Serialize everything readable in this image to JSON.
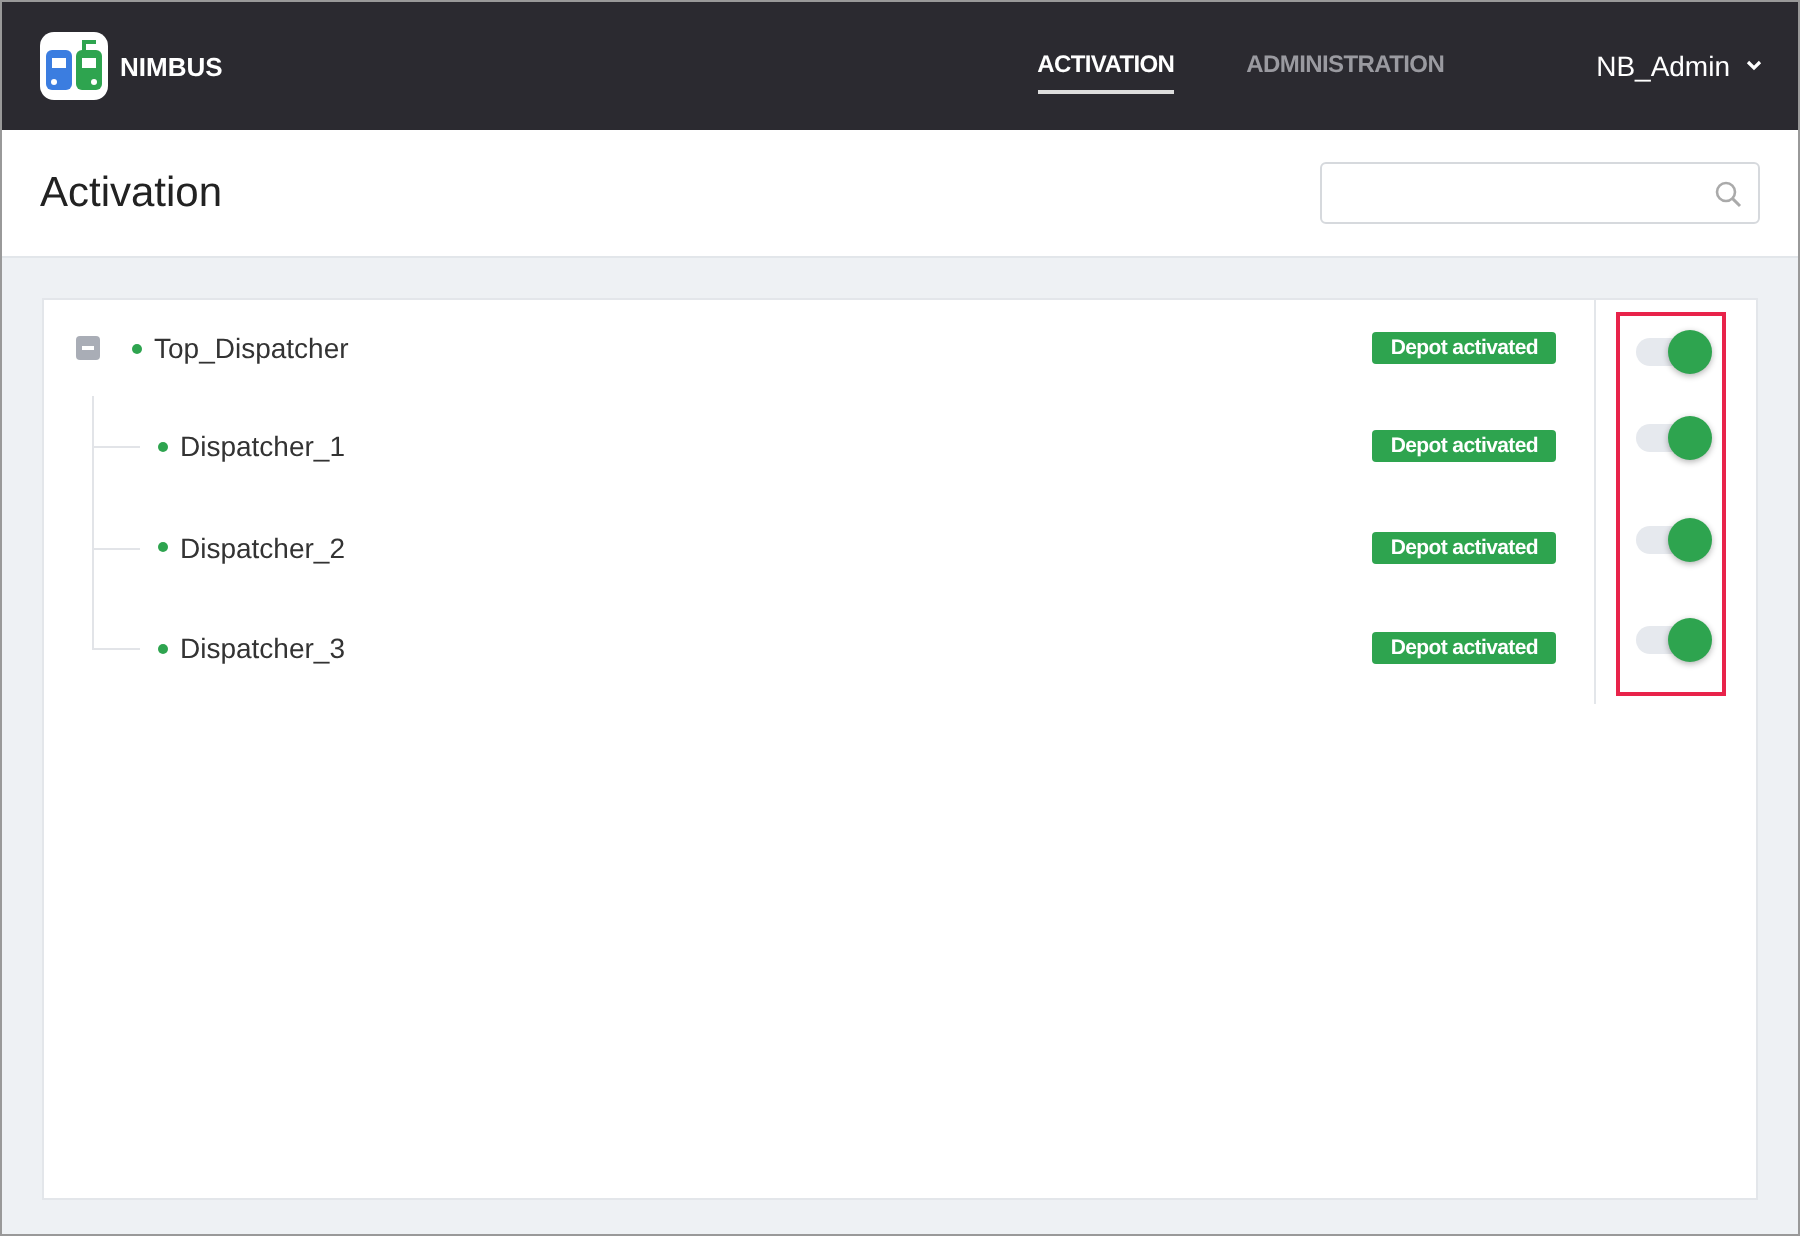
{
  "app": {
    "name": "NIMBUS"
  },
  "nav": [
    {
      "label": "ACTIVATION",
      "selected": true
    },
    {
      "label": "ADMINISTRATION",
      "selected": false
    }
  ],
  "user": {
    "name": "NB_Admin"
  },
  "page": {
    "title": "Activation"
  },
  "tree": [
    {
      "name": "Top_Dispatcher",
      "badge": "Depot activated",
      "on": true,
      "expanded": true,
      "children": [
        {
          "name": "Dispatcher_1",
          "badge": "Depot activated",
          "on": true
        },
        {
          "name": "Dispatcher_2",
          "badge": "Depot activated",
          "on": true
        },
        {
          "name": "Dispatcher_3",
          "badge": "Depot activated",
          "on": true
        }
      ]
    }
  ]
}
